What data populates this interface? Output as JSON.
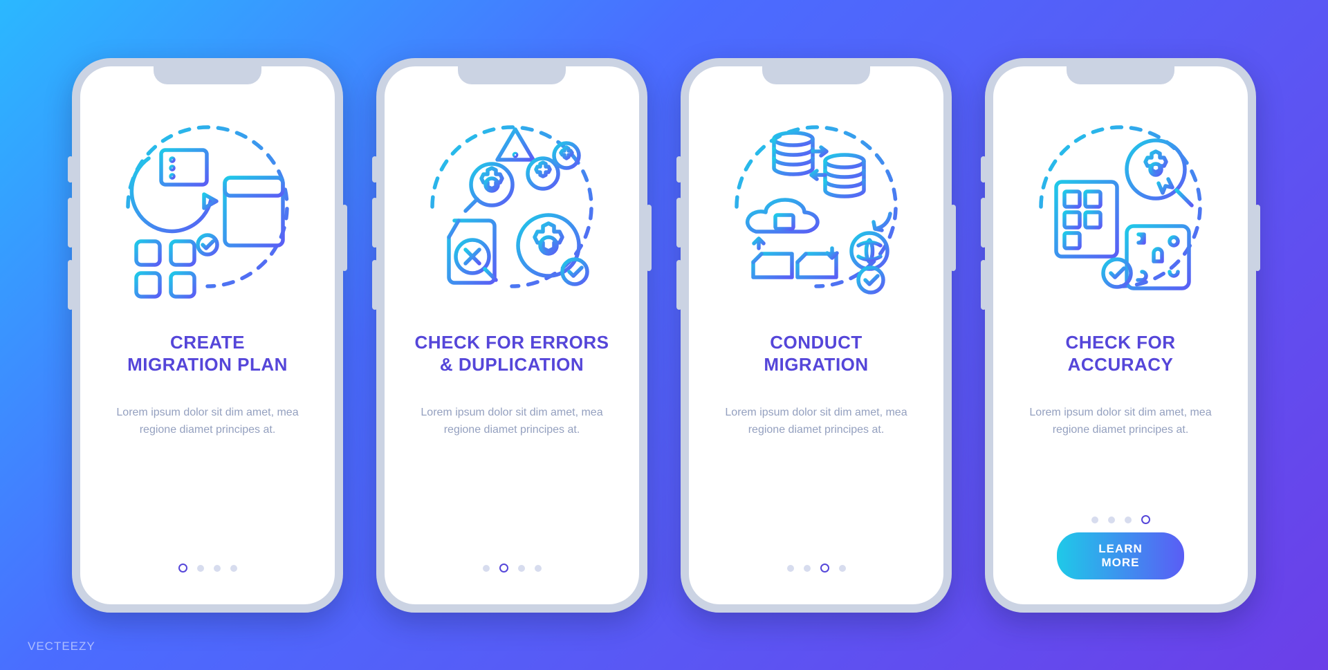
{
  "watermark": "VECTEEZY",
  "gradient_stops": {
    "from": "#1FC9E8",
    "to": "#5A5DF5"
  },
  "body_text": "Lorem ipsum dolor sit dim amet, mea regione diamet principes at.",
  "cta_label": "LEARN MORE",
  "screens": [
    {
      "title": "CREATE\nMIGRATION PLAN",
      "icon": "plan-icon",
      "active_dot": 0
    },
    {
      "title": "CHECK FOR ERRORS\n& DUPLICATION",
      "icon": "errors-icon",
      "active_dot": 1
    },
    {
      "title": "CONDUCT\nMIGRATION",
      "icon": "conduct-icon",
      "active_dot": 2
    },
    {
      "title": "CHECK FOR\nACCURACY",
      "icon": "accuracy-icon",
      "active_dot": 3
    }
  ]
}
